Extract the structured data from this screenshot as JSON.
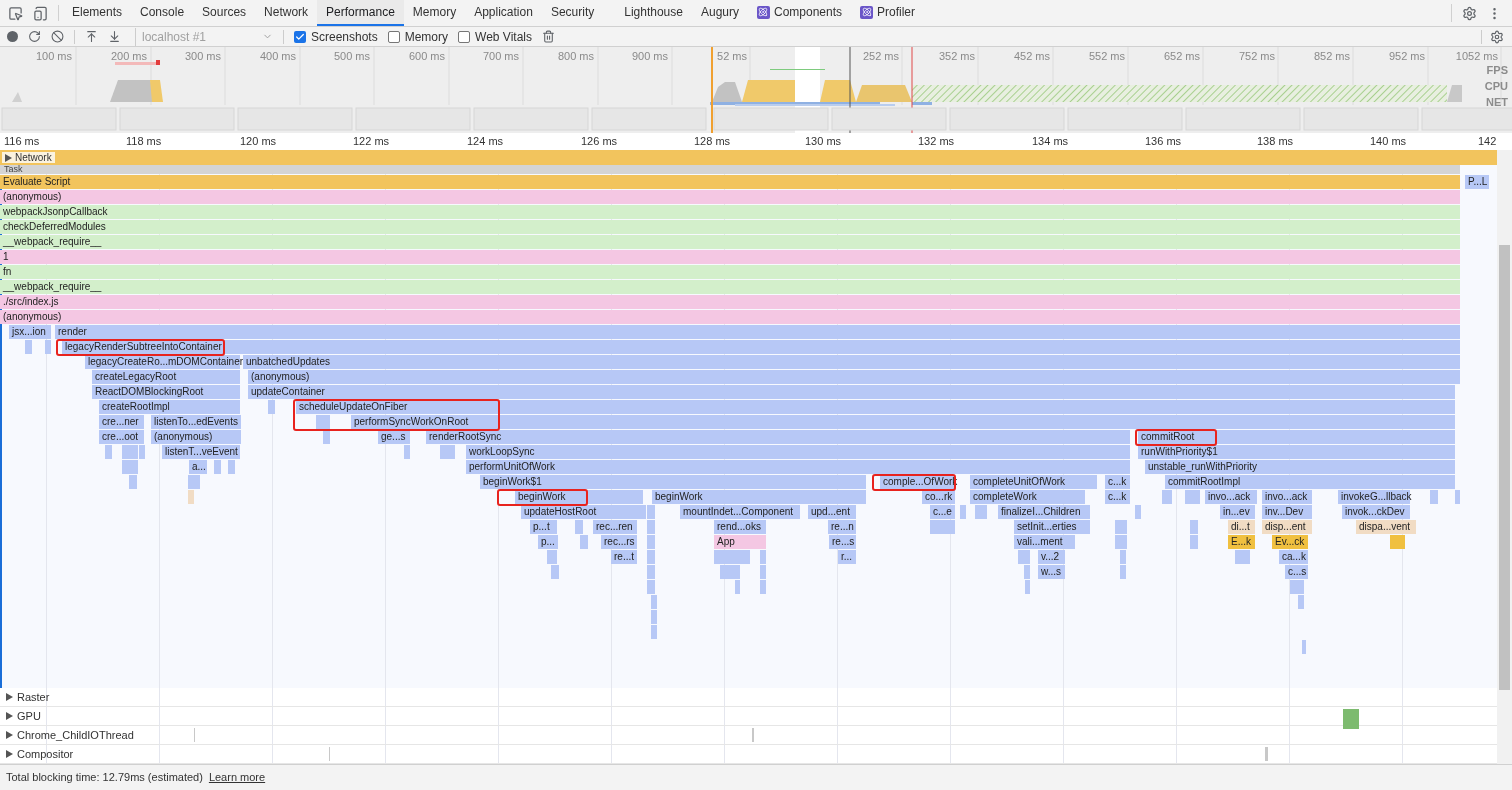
{
  "tabs": [
    {
      "label": "Elements",
      "selected": false,
      "kind": "plain"
    },
    {
      "label": "Console",
      "selected": false,
      "kind": "plain"
    },
    {
      "label": "Sources",
      "selected": false,
      "kind": "plain"
    },
    {
      "label": "Network",
      "selected": false,
      "kind": "plain"
    },
    {
      "label": "Performance",
      "selected": true,
      "kind": "plain"
    },
    {
      "label": "Memory",
      "selected": false,
      "kind": "plain"
    },
    {
      "label": "Application",
      "selected": false,
      "kind": "plain"
    },
    {
      "label": "Security",
      "selected": false,
      "kind": "plain"
    },
    {
      "label": "Lighthouse",
      "selected": false,
      "kind": "plain"
    },
    {
      "label": "Augury",
      "selected": false,
      "kind": "plain"
    },
    {
      "label": "Components",
      "selected": false,
      "kind": "react"
    },
    {
      "label": "Profiler",
      "selected": false,
      "kind": "react"
    }
  ],
  "toolbar": {
    "target": "localhost #1",
    "options": [
      {
        "label": "Screenshots",
        "checked": true
      },
      {
        "label": "Memory",
        "checked": false
      },
      {
        "label": "Web Vitals",
        "checked": false
      }
    ]
  },
  "overview": {
    "ticks": [
      "100 ms",
      "200 ms",
      "300 ms",
      "400 ms",
      "500 ms",
      "600 ms",
      "700 ms",
      "800 ms",
      "900 ms"
    ],
    "detail_ticks": [
      "52 ms",
      "252 ms",
      "352 ms",
      "452 ms",
      "552 ms",
      "652 ms",
      "752 ms",
      "852 ms",
      "952 ms",
      "1052 ms"
    ],
    "lanes": [
      "FPS",
      "CPU",
      "NET"
    ]
  },
  "ruler": [
    "116 ms",
    "118 ms",
    "120 ms",
    "122 ms",
    "124 ms",
    "126 ms",
    "128 ms",
    "130 ms",
    "132 ms",
    "134 ms",
    "136 ms",
    "138 ms",
    "140 ms",
    "142"
  ],
  "network_track": {
    "label": "Network",
    "expanded": false
  },
  "task_label": "Task",
  "flame_rows": [
    [
      {
        "label": "Evaluate Script",
        "kind": "script"
      },
      {
        "label": "P...L",
        "kind": "function"
      }
    ],
    [
      {
        "label": "(anonymous)",
        "kind": "call"
      }
    ],
    [
      {
        "label": "webpackJsonpCallback",
        "kind": "module"
      }
    ],
    [
      {
        "label": "checkDeferredModules",
        "kind": "module"
      }
    ],
    [
      {
        "label": "__webpack_require__",
        "kind": "module"
      }
    ],
    [
      {
        "label": "1",
        "kind": "call"
      }
    ],
    [
      {
        "label": "fn",
        "kind": "module"
      }
    ],
    [
      {
        "label": "__webpack_require__",
        "kind": "module"
      }
    ],
    [
      {
        "label": "./src/index.js",
        "kind": "call"
      }
    ],
    [
      {
        "label": "(anonymous)",
        "kind": "call"
      }
    ],
    [
      {
        "label": "jsx...ion",
        "kind": "function"
      },
      {
        "label": "render",
        "kind": "function"
      }
    ],
    [
      {
        "label": "legacyRenderSubtreeIntoContainer",
        "kind": "function",
        "highlighted": true
      }
    ],
    [
      {
        "label": "legacyCreateRo...mDOMContainer",
        "kind": "function"
      },
      {
        "label": "unbatchedUpdates",
        "kind": "function"
      }
    ],
    [
      {
        "label": "createLegacyRoot",
        "kind": "function"
      },
      {
        "label": "(anonymous)",
        "kind": "function"
      }
    ],
    [
      {
        "label": "ReactDOMBlockingRoot",
        "kind": "function"
      },
      {
        "label": "updateContainer",
        "kind": "function"
      }
    ],
    [
      {
        "label": "createRootImpl",
        "kind": "function"
      },
      {
        "label": "scheduleUpdateOnFiber",
        "kind": "function",
        "highlighted": true
      }
    ],
    [
      {
        "label": "cre...ner",
        "kind": "function"
      },
      {
        "label": "listenTo...edEvents",
        "kind": "function"
      },
      {
        "label": "performSyncWorkOnRoot",
        "kind": "function"
      }
    ],
    [
      {
        "label": "cre...oot",
        "kind": "function"
      },
      {
        "label": "(anonymous)",
        "kind": "function"
      },
      {
        "label": "ge...s",
        "kind": "function"
      },
      {
        "label": "renderRootSync",
        "kind": "function"
      },
      {
        "label": "commitRoot",
        "kind": "function",
        "highlighted": true
      }
    ],
    [
      {
        "label": "listenT...veEvent",
        "kind": "function"
      },
      {
        "label": "workLoopSync",
        "kind": "function"
      },
      {
        "label": "runWithPriority$1",
        "kind": "function"
      }
    ],
    [
      {
        "label": "a...",
        "kind": "function"
      },
      {
        "label": "performUnitOfWork",
        "kind": "function"
      },
      {
        "label": "unstable_runWithPriority",
        "kind": "function"
      }
    ],
    [
      {
        "label": "beginWork$1",
        "kind": "function"
      },
      {
        "label": "comple...OfWork",
        "kind": "function",
        "highlighted": true
      },
      {
        "label": "completeUnitOfWork",
        "kind": "function"
      },
      {
        "label": "c...k",
        "kind": "function"
      },
      {
        "label": "commitRootImpl",
        "kind": "function"
      }
    ],
    [
      {
        "label": "beginWork",
        "kind": "function",
        "highlighted": true
      },
      {
        "label": "beginWork",
        "kind": "function"
      },
      {
        "label": "co...rk",
        "kind": "function"
      },
      {
        "label": "completeWork",
        "kind": "function"
      },
      {
        "label": "c...k",
        "kind": "function"
      },
      {
        "label": "invo...ack",
        "kind": "function"
      },
      {
        "label": "invo...ack",
        "kind": "function"
      },
      {
        "label": "invokeG...llback",
        "kind": "function"
      }
    ],
    [
      {
        "label": "updateHostRoot",
        "kind": "function"
      },
      {
        "label": "mountIndet...Component",
        "kind": "function"
      },
      {
        "label": "upd...ent",
        "kind": "function"
      },
      {
        "label": "c...e",
        "kind": "function"
      },
      {
        "label": "finalizeI...Children",
        "kind": "function"
      },
      {
        "label": "in...ev",
        "kind": "function"
      },
      {
        "label": "inv...Dev",
        "kind": "function"
      },
      {
        "label": "invok...ckDev",
        "kind": "function"
      }
    ],
    [
      {
        "label": "p...t",
        "kind": "function"
      },
      {
        "label": "rec...ren",
        "kind": "function"
      },
      {
        "label": "rend...oks",
        "kind": "function"
      },
      {
        "label": "re...n",
        "kind": "function"
      },
      {
        "label": "setInit...erties",
        "kind": "function"
      },
      {
        "label": "di...t",
        "kind": "event"
      },
      {
        "label": "disp...ent",
        "kind": "event"
      },
      {
        "label": "dispa...vent",
        "kind": "event"
      }
    ],
    [
      {
        "label": "p...",
        "kind": "function"
      },
      {
        "label": "rec...rs",
        "kind": "function"
      },
      {
        "label": "App",
        "kind": "call"
      },
      {
        "label": "re...s",
        "kind": "function"
      },
      {
        "label": "vali...ment",
        "kind": "function"
      },
      {
        "label": "E...k",
        "kind": "handler"
      },
      {
        "label": "Ev...ck",
        "kind": "handler"
      }
    ],
    [
      {
        "label": "re...t",
        "kind": "function"
      },
      {
        "label": "r...",
        "kind": "function"
      },
      {
        "label": "v...2",
        "kind": "function"
      },
      {
        "label": "ca...k",
        "kind": "function"
      }
    ],
    [
      {
        "label": "w...s",
        "kind": "function"
      },
      {
        "label": "c...s",
        "kind": "function"
      }
    ]
  ],
  "tracks": [
    {
      "label": "Raster",
      "expanded": false
    },
    {
      "label": "GPU",
      "expanded": false
    },
    {
      "label": "Chrome_ChildIOThread",
      "expanded": false
    },
    {
      "label": "Compositor",
      "expanded": false
    }
  ],
  "status": {
    "text": "Total blocking time: 12.79ms (estimated)",
    "link": "Learn more"
  }
}
